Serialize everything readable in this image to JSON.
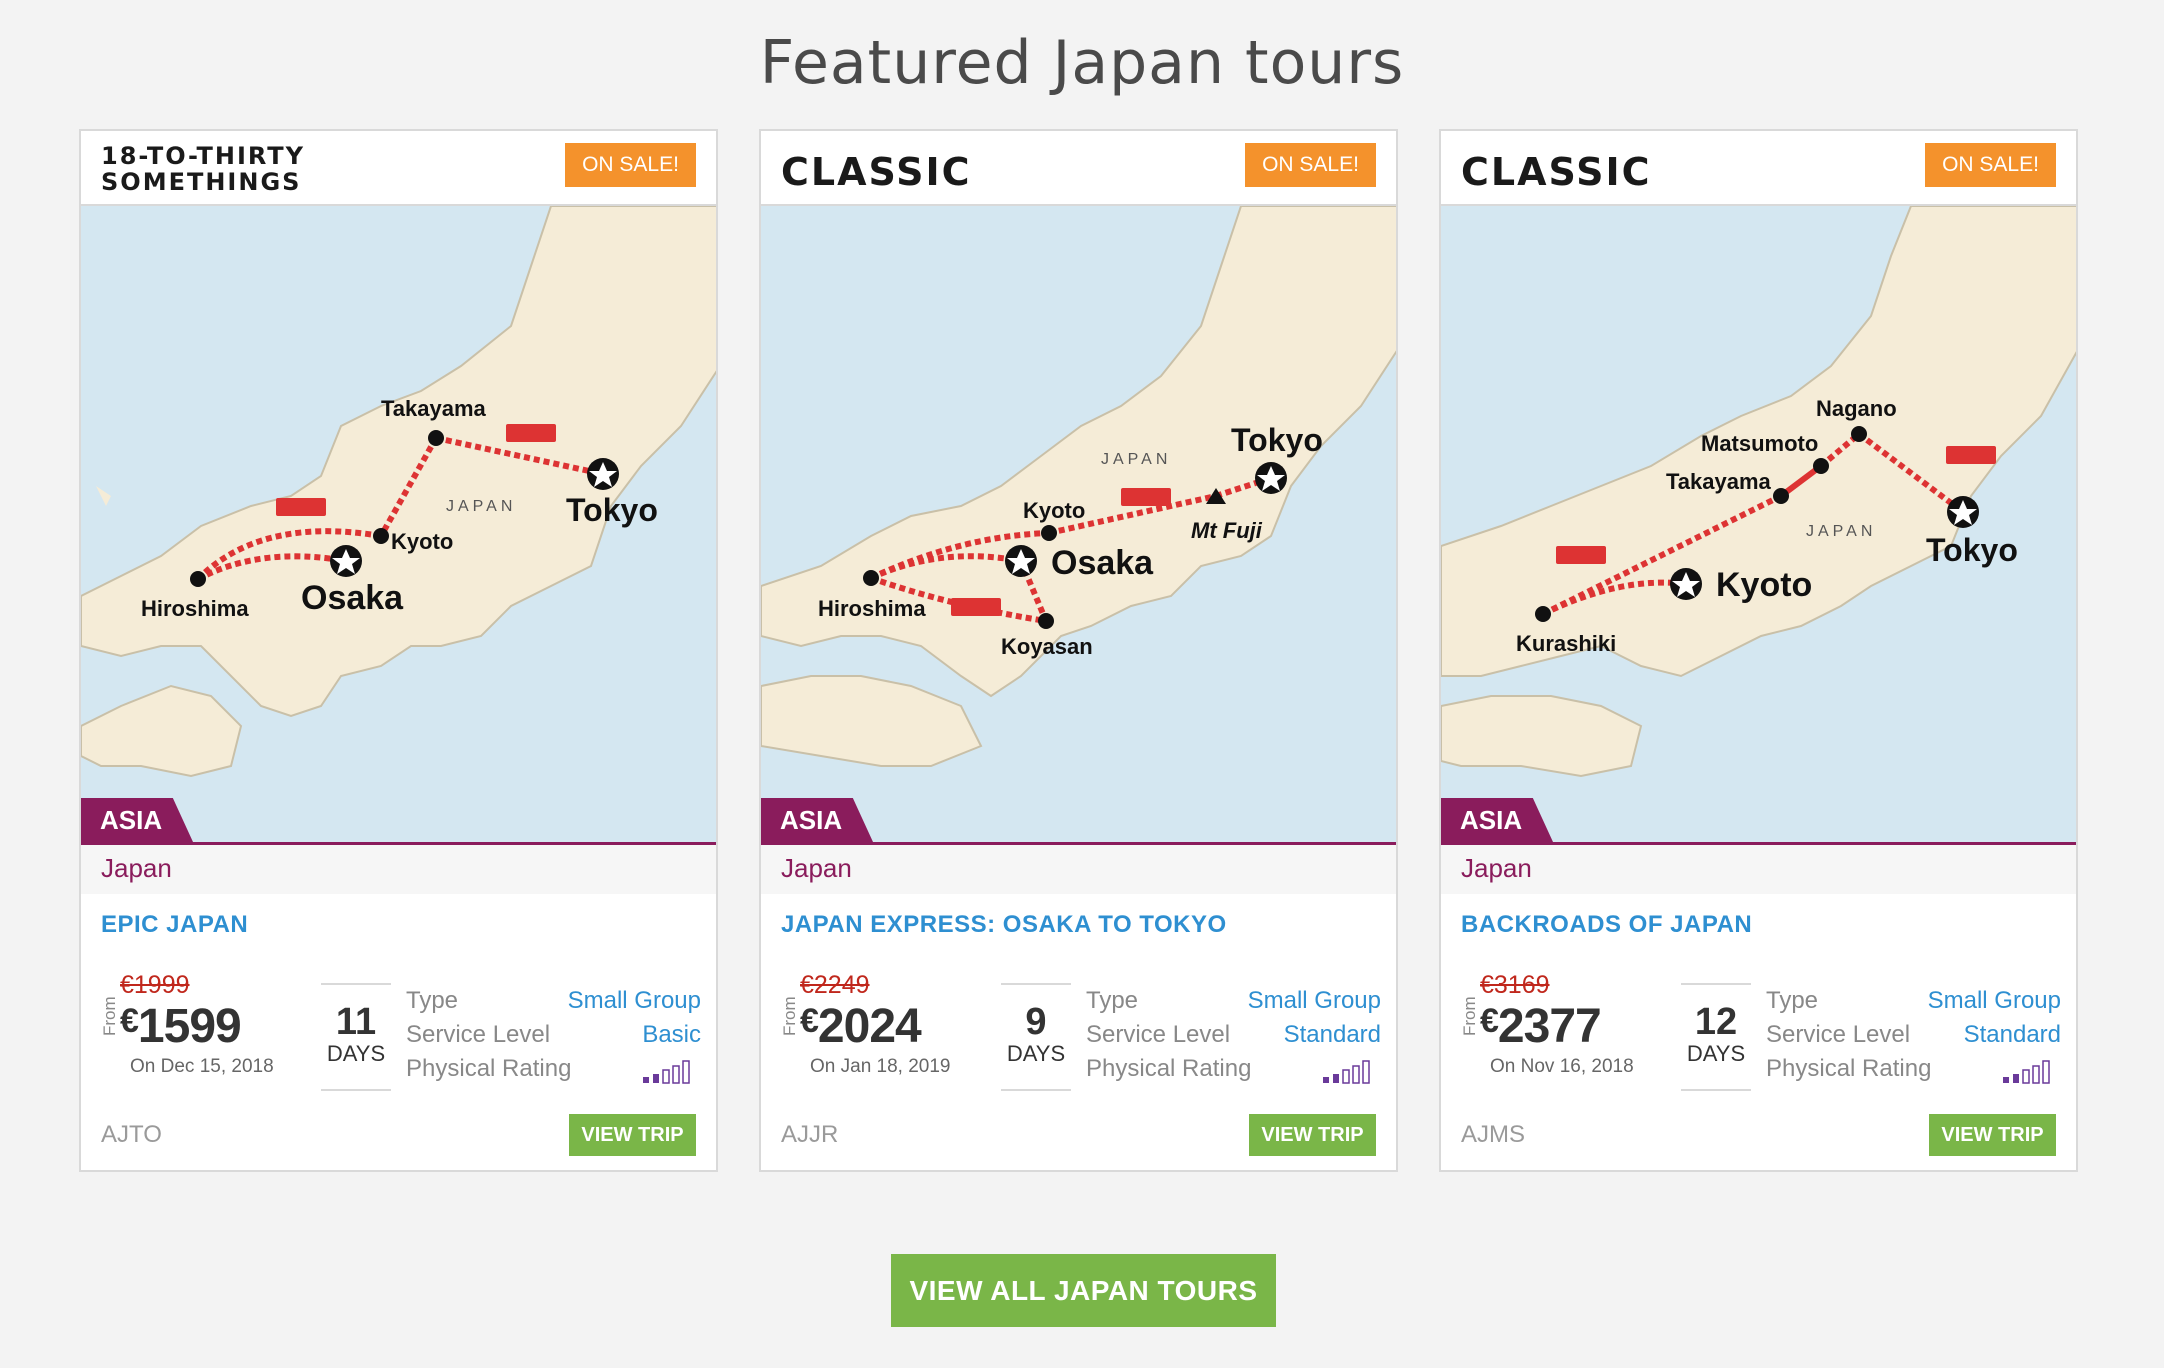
{
  "page": {
    "title": "Featured Japan tours"
  },
  "colors": {
    "sale": "#f4922c",
    "region": "#8a1c5c",
    "link": "#2e8fd1",
    "cta": "#7ab648",
    "old_price": "#c0271c"
  },
  "common": {
    "from_label": "From",
    "days_label": "DAYS",
    "type_label": "Type",
    "service_label": "Service Level",
    "rating_label": "Physical Rating",
    "view_trip": "VIEW TRIP"
  },
  "cards": [
    {
      "style": "18-TO-THIRTY SOMETHINGS",
      "sale": "ON SALE!",
      "region": "ASIA",
      "country": "Japan",
      "trip_name": "EPIC JAPAN",
      "old_price": "€1999",
      "currency": "€",
      "price": "1599",
      "date": "On Dec 15, 2018",
      "days": "11",
      "type": "Small Group",
      "service": "Basic",
      "code": "AJTO",
      "physical_rating": 2,
      "map": {
        "country_label": "JAPAN",
        "cities": [
          "Takayama",
          "Kyoto",
          "Tokyo",
          "Hiroshima",
          "Osaka"
        ]
      }
    },
    {
      "style": "CLASSIC",
      "sale": "ON SALE!",
      "region": "ASIA",
      "country": "Japan",
      "trip_name": "JAPAN EXPRESS: OSAKA TO TOKYO",
      "old_price": "€2249",
      "currency": "€",
      "price": "2024",
      "date": "On Jan 18, 2019",
      "days": "9",
      "type": "Small Group",
      "service": "Standard",
      "code": "AJJR",
      "physical_rating": 2,
      "map": {
        "country_label": "JAPAN",
        "cities": [
          "Tokyo",
          "Kyoto",
          "Mt Fuji",
          "Osaka",
          "Hiroshima",
          "Koyasan"
        ]
      }
    },
    {
      "style": "CLASSIC",
      "sale": "ON SALE!",
      "region": "ASIA",
      "country": "Japan",
      "trip_name": "BACKROADS OF JAPAN",
      "old_price": "€3169",
      "currency": "€",
      "price": "2377",
      "date": "On Nov 16, 2018",
      "days": "12",
      "type": "Small Group",
      "service": "Standard",
      "code": "AJMS",
      "physical_rating": 2,
      "map": {
        "country_label": "JAPAN",
        "cities": [
          "Nagano",
          "Matsumoto",
          "Takayama",
          "Tokyo",
          "Kyoto",
          "Kurashiki"
        ]
      }
    }
  ],
  "footer": {
    "view_all": "VIEW ALL JAPAN TOURS"
  }
}
